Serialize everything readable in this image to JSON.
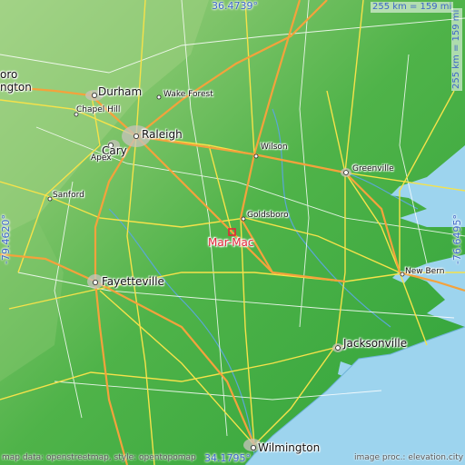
{
  "map": {
    "target": {
      "name": "Mar-Mac",
      "marker_color": "#e3263a"
    },
    "cities": [
      {
        "id": "durham",
        "name": "Durham",
        "size": "big"
      },
      {
        "id": "raleigh",
        "name": "Raleigh",
        "size": "big"
      },
      {
        "id": "cary",
        "name": "Cary",
        "size": "big"
      },
      {
        "id": "chapel-hill",
        "name": "Chapel Hill",
        "size": "small"
      },
      {
        "id": "apex",
        "name": "Apex",
        "size": "small"
      },
      {
        "id": "wake-forest",
        "name": "Wake Forest",
        "size": "small"
      },
      {
        "id": "wilson",
        "name": "Wilson",
        "size": "small"
      },
      {
        "id": "greenville",
        "name": "Greenville",
        "size": "small"
      },
      {
        "id": "goldsboro",
        "name": "Goldsboro",
        "size": "small"
      },
      {
        "id": "sanford",
        "name": "Sanford",
        "size": "small"
      },
      {
        "id": "fayetteville",
        "name": "Fayetteville",
        "size": "big"
      },
      {
        "id": "new-bern",
        "name": "New Bern",
        "size": "small"
      },
      {
        "id": "jacksonville",
        "name": "Jacksonville",
        "size": "big"
      },
      {
        "id": "wilmington",
        "name": "Wilmington",
        "size": "big"
      },
      {
        "id": "edge-oro",
        "name": "oro",
        "size": "big"
      },
      {
        "id": "edge-ngton",
        "name": "ngton",
        "size": "big"
      }
    ],
    "coordinates": {
      "top": "36.4739°",
      "bottom": "34.1795°",
      "left": "-79.4620°",
      "right": "-76.6495°"
    },
    "scale": {
      "horizontal": "255 km = 159 mi",
      "vertical": "255 km = 159 mi"
    },
    "credits": {
      "left": "map data: openstreetmap, style: opentopomap",
      "right": "image proc.: elevation.city"
    },
    "colors": {
      "lowland": "#37a83a",
      "upland": "#7fc46a",
      "water": "#9dd4ee",
      "road_major": "#f4a23c",
      "road_minor": "#f6e24a",
      "road_small": "#ffffff"
    }
  }
}
